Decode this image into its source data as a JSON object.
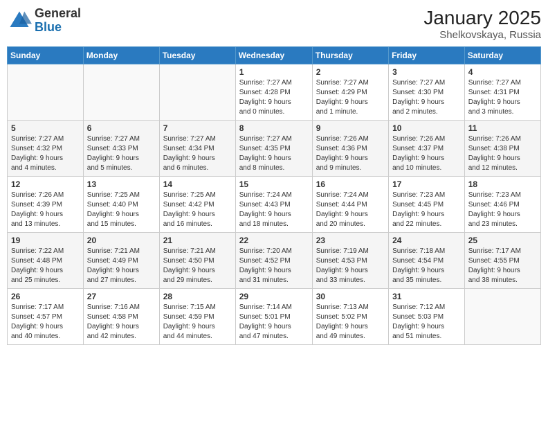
{
  "header": {
    "logo_general": "General",
    "logo_blue": "Blue",
    "title": "January 2025",
    "subtitle": "Shelkovskaya, Russia"
  },
  "weekdays": [
    "Sunday",
    "Monday",
    "Tuesday",
    "Wednesday",
    "Thursday",
    "Friday",
    "Saturday"
  ],
  "weeks": [
    [
      {
        "day": "",
        "info": ""
      },
      {
        "day": "",
        "info": ""
      },
      {
        "day": "",
        "info": ""
      },
      {
        "day": "1",
        "info": "Sunrise: 7:27 AM\nSunset: 4:28 PM\nDaylight: 9 hours\nand 0 minutes."
      },
      {
        "day": "2",
        "info": "Sunrise: 7:27 AM\nSunset: 4:29 PM\nDaylight: 9 hours\nand 1 minute."
      },
      {
        "day": "3",
        "info": "Sunrise: 7:27 AM\nSunset: 4:30 PM\nDaylight: 9 hours\nand 2 minutes."
      },
      {
        "day": "4",
        "info": "Sunrise: 7:27 AM\nSunset: 4:31 PM\nDaylight: 9 hours\nand 3 minutes."
      }
    ],
    [
      {
        "day": "5",
        "info": "Sunrise: 7:27 AM\nSunset: 4:32 PM\nDaylight: 9 hours\nand 4 minutes."
      },
      {
        "day": "6",
        "info": "Sunrise: 7:27 AM\nSunset: 4:33 PM\nDaylight: 9 hours\nand 5 minutes."
      },
      {
        "day": "7",
        "info": "Sunrise: 7:27 AM\nSunset: 4:34 PM\nDaylight: 9 hours\nand 6 minutes."
      },
      {
        "day": "8",
        "info": "Sunrise: 7:27 AM\nSunset: 4:35 PM\nDaylight: 9 hours\nand 8 minutes."
      },
      {
        "day": "9",
        "info": "Sunrise: 7:26 AM\nSunset: 4:36 PM\nDaylight: 9 hours\nand 9 minutes."
      },
      {
        "day": "10",
        "info": "Sunrise: 7:26 AM\nSunset: 4:37 PM\nDaylight: 9 hours\nand 10 minutes."
      },
      {
        "day": "11",
        "info": "Sunrise: 7:26 AM\nSunset: 4:38 PM\nDaylight: 9 hours\nand 12 minutes."
      }
    ],
    [
      {
        "day": "12",
        "info": "Sunrise: 7:26 AM\nSunset: 4:39 PM\nDaylight: 9 hours\nand 13 minutes."
      },
      {
        "day": "13",
        "info": "Sunrise: 7:25 AM\nSunset: 4:40 PM\nDaylight: 9 hours\nand 15 minutes."
      },
      {
        "day": "14",
        "info": "Sunrise: 7:25 AM\nSunset: 4:42 PM\nDaylight: 9 hours\nand 16 minutes."
      },
      {
        "day": "15",
        "info": "Sunrise: 7:24 AM\nSunset: 4:43 PM\nDaylight: 9 hours\nand 18 minutes."
      },
      {
        "day": "16",
        "info": "Sunrise: 7:24 AM\nSunset: 4:44 PM\nDaylight: 9 hours\nand 20 minutes."
      },
      {
        "day": "17",
        "info": "Sunrise: 7:23 AM\nSunset: 4:45 PM\nDaylight: 9 hours\nand 22 minutes."
      },
      {
        "day": "18",
        "info": "Sunrise: 7:23 AM\nSunset: 4:46 PM\nDaylight: 9 hours\nand 23 minutes."
      }
    ],
    [
      {
        "day": "19",
        "info": "Sunrise: 7:22 AM\nSunset: 4:48 PM\nDaylight: 9 hours\nand 25 minutes."
      },
      {
        "day": "20",
        "info": "Sunrise: 7:21 AM\nSunset: 4:49 PM\nDaylight: 9 hours\nand 27 minutes."
      },
      {
        "day": "21",
        "info": "Sunrise: 7:21 AM\nSunset: 4:50 PM\nDaylight: 9 hours\nand 29 minutes."
      },
      {
        "day": "22",
        "info": "Sunrise: 7:20 AM\nSunset: 4:52 PM\nDaylight: 9 hours\nand 31 minutes."
      },
      {
        "day": "23",
        "info": "Sunrise: 7:19 AM\nSunset: 4:53 PM\nDaylight: 9 hours\nand 33 minutes."
      },
      {
        "day": "24",
        "info": "Sunrise: 7:18 AM\nSunset: 4:54 PM\nDaylight: 9 hours\nand 35 minutes."
      },
      {
        "day": "25",
        "info": "Sunrise: 7:17 AM\nSunset: 4:55 PM\nDaylight: 9 hours\nand 38 minutes."
      }
    ],
    [
      {
        "day": "26",
        "info": "Sunrise: 7:17 AM\nSunset: 4:57 PM\nDaylight: 9 hours\nand 40 minutes."
      },
      {
        "day": "27",
        "info": "Sunrise: 7:16 AM\nSunset: 4:58 PM\nDaylight: 9 hours\nand 42 minutes."
      },
      {
        "day": "28",
        "info": "Sunrise: 7:15 AM\nSunset: 4:59 PM\nDaylight: 9 hours\nand 44 minutes."
      },
      {
        "day": "29",
        "info": "Sunrise: 7:14 AM\nSunset: 5:01 PM\nDaylight: 9 hours\nand 47 minutes."
      },
      {
        "day": "30",
        "info": "Sunrise: 7:13 AM\nSunset: 5:02 PM\nDaylight: 9 hours\nand 49 minutes."
      },
      {
        "day": "31",
        "info": "Sunrise: 7:12 AM\nSunset: 5:03 PM\nDaylight: 9 hours\nand 51 minutes."
      },
      {
        "day": "",
        "info": ""
      }
    ]
  ]
}
